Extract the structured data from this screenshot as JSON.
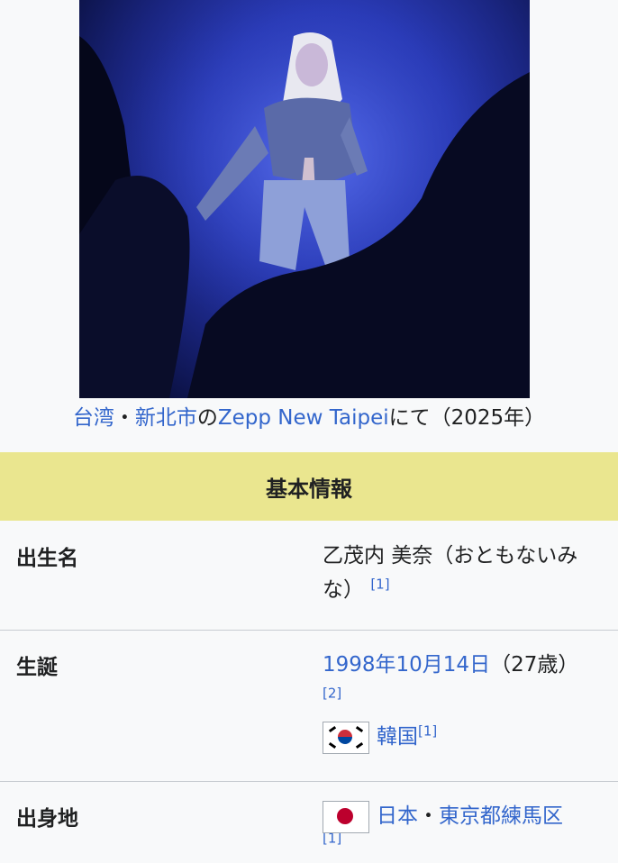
{
  "caption": {
    "link1": "台湾",
    "sep1": "・",
    "link2": "新北市",
    "text1": "の",
    "link3": "Zepp New Taipei",
    "text2": "にて（2025年）"
  },
  "infobox": {
    "section_title": "基本情報",
    "birth_name": {
      "label": "出生名",
      "value": "乙茂内 美奈（おともないみな）",
      "ref": "[1]"
    },
    "born": {
      "label": "生誕",
      "date_link": "1998年10月14日",
      "age": "（27歳）",
      "ref": "[2]",
      "nationality_flag": "south-korea-flag",
      "nationality": "韓国",
      "nationality_ref": "[1]"
    },
    "birthplace": {
      "label": "出身地",
      "flag": "japan-flag",
      "country": "日本",
      "sep": "・",
      "place": "東京都練馬区",
      "ref": "[1]"
    }
  }
}
